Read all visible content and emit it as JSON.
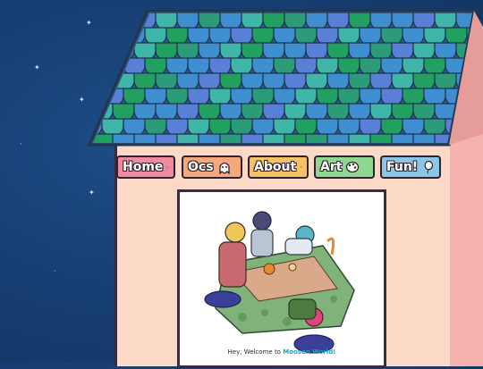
{
  "nav": {
    "home": "Home",
    "ocs": "Ocs",
    "about": "About",
    "art": "Art",
    "fun": "Fun!"
  },
  "welcome": {
    "prefix": "Hey, Welcome to ",
    "site_name": "Moosen World!"
  },
  "colors": {
    "sky": "#173f74",
    "wall": "#fbd9c6",
    "roof_blue": "#3f8fd0",
    "roof_green": "#22a060",
    "home_btn": "#f08aa0",
    "ocs_btn": "#f5a97a",
    "about_btn": "#f5c167",
    "art_btn": "#8fd890",
    "fun_btn": "#8cc6e6"
  },
  "icons": [
    "home-icon",
    "ghost-icon",
    "question-icon",
    "palette-icon",
    "balloon-icon"
  ]
}
